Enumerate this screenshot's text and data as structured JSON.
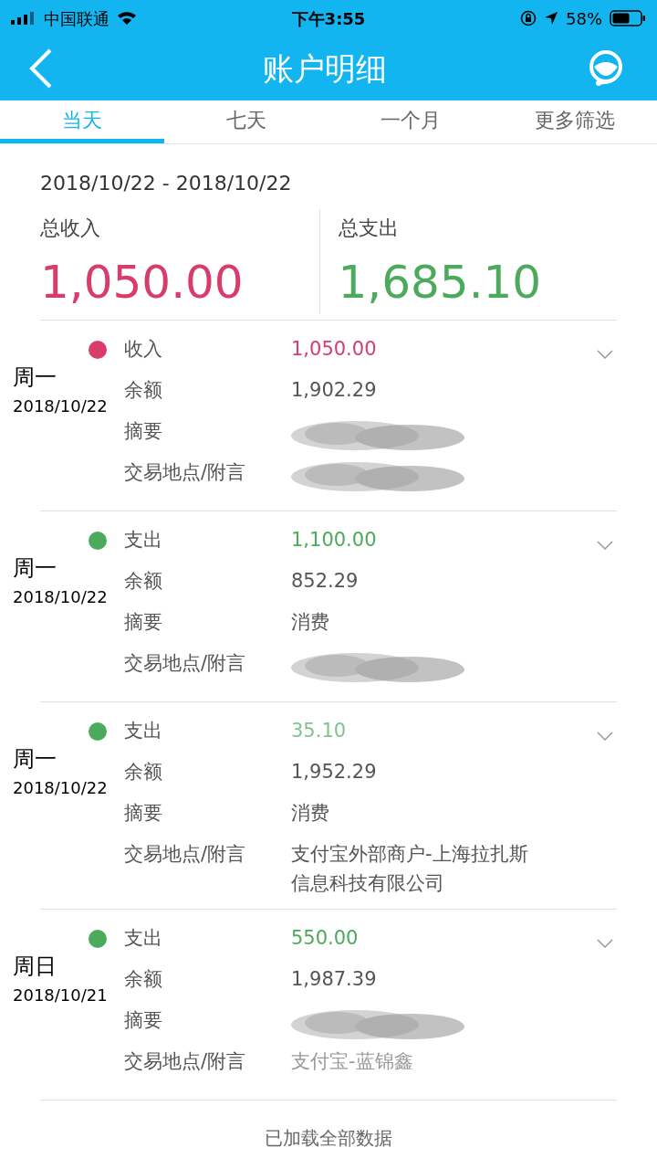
{
  "status_bar": {
    "carrier": "中国联通",
    "time": "下午3:55",
    "battery": "58%"
  },
  "header": {
    "title": "账户明细"
  },
  "tabs": [
    {
      "label": "当天",
      "selected": true
    },
    {
      "label": "七天",
      "selected": false
    },
    {
      "label": "一个月",
      "selected": false
    },
    {
      "label": "更多筛选",
      "selected": false
    }
  ],
  "date_range": "2018/10/22 - 2018/10/22",
  "summary": [
    {
      "kind": "income",
      "label": "总收入",
      "amount": "1,050.00"
    },
    {
      "kind": "expense",
      "label": "总支出",
      "amount": "1,685.10"
    }
  ],
  "transactions": [
    {
      "kind": "income",
      "weekday": "周一",
      "date": "2018/10/22",
      "fields": [
        {
          "label": "收入",
          "value": "1,050.00",
          "kind": "amount"
        },
        {
          "label": "余额",
          "value": "1,902.29",
          "kind": "text"
        },
        {
          "label": "摘要",
          "kind": "redacted"
        },
        {
          "label": "交易地点/附言",
          "kind": "redacted"
        }
      ]
    },
    {
      "kind": "expense",
      "weekday": "周一",
      "date": "2018/10/22",
      "fields": [
        {
          "label": "支出",
          "value": "1,100.00",
          "kind": "amount"
        },
        {
          "label": "余额",
          "value": "852.29",
          "kind": "text"
        },
        {
          "label": "摘要",
          "value": "消费",
          "kind": "text"
        },
        {
          "label": "交易地点/附言",
          "kind": "redacted"
        }
      ]
    },
    {
      "kind": "expense",
      "weekday": "周一",
      "date": "2018/10/22",
      "fields": [
        {
          "label": "支出",
          "value": "35.10",
          "kind": "faint_amount"
        },
        {
          "label": "余额",
          "value": "1,952.29",
          "kind": "text"
        },
        {
          "label": "摘要",
          "value": "消费",
          "kind": "text"
        },
        {
          "label": "交易地点/附言",
          "value": "支付宝外部商户-上海拉扎斯信息科技有限公司",
          "kind": "text"
        }
      ]
    },
    {
      "kind": "expense",
      "weekday": "周日",
      "date": "2018/10/21",
      "fields": [
        {
          "label": "支出",
          "value": "550.00",
          "kind": "amount"
        },
        {
          "label": "余额",
          "value": "1,987.39",
          "kind": "text"
        },
        {
          "label": "摘要",
          "kind": "redacted"
        },
        {
          "label": "交易地点/附言",
          "value": "支付宝-蓝锦鑫",
          "kind": "faint"
        }
      ]
    }
  ],
  "footer": "已加载全部数据"
}
